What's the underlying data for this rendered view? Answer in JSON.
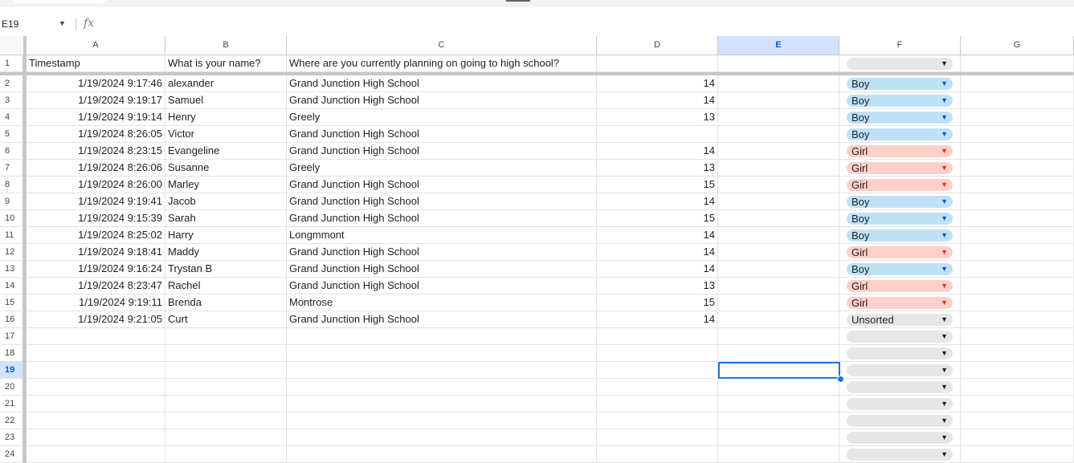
{
  "formula_bar": {
    "name_box": "E19",
    "fx_icon": "fx"
  },
  "columns": [
    "A",
    "B",
    "C",
    "D",
    "E",
    "F",
    "G"
  ],
  "selected_column": "E",
  "selected_row": 19,
  "colors": {
    "boy_chip": "#bfe1f6",
    "girl_chip": "#ffcfc9",
    "neutral_chip": "#e6e6e6",
    "selection": "#1a73e8"
  },
  "header_row": {
    "num": "1",
    "a": "Timestamp",
    "b": "What is your name?",
    "c": "Where are you currently planning on going to high school?",
    "d": "",
    "e": "",
    "f": ""
  },
  "rows": [
    {
      "num": "2",
      "a": "1/19/2024 9:17:46",
      "b": "alexander",
      "c": "Grand Junction High School",
      "d": "14",
      "f": "Boy"
    },
    {
      "num": "3",
      "a": "1/19/2024 9:19:17",
      "b": "Samuel",
      "c": "Grand Junction High School",
      "d": "14",
      "f": "Boy"
    },
    {
      "num": "4",
      "a": "1/19/2024 9:19:14",
      "b": "Henry",
      "c": "Greely",
      "d": "13",
      "f": "Boy"
    },
    {
      "num": "5",
      "a": "1/19/2024 8:26:05",
      "b": "Victor",
      "c": "Grand Junction High School",
      "d": "",
      "f": "Boy"
    },
    {
      "num": "6",
      "a": "1/19/2024 8:23:15",
      "b": "Evangeline",
      "c": "Grand Junction High School",
      "d": "14",
      "f": "Girl"
    },
    {
      "num": "7",
      "a": "1/19/2024 8:26:06",
      "b": "Susanne",
      "c": "Greely",
      "d": "13",
      "f": "Girl"
    },
    {
      "num": "8",
      "a": "1/19/2024 8:26:00",
      "b": "Marley",
      "c": "Grand Junction High School",
      "d": "15",
      "f": "Girl"
    },
    {
      "num": "9",
      "a": "1/19/2024 9:19:41",
      "b": "Jacob",
      "c": "Grand Junction High School",
      "d": "14",
      "f": "Boy"
    },
    {
      "num": "10",
      "a": "1/19/2024 9:15:39",
      "b": "Sarah",
      "c": "Grand Junction High School",
      "d": "15",
      "f": "Boy"
    },
    {
      "num": "11",
      "a": "1/19/2024 8:25:02",
      "b": "Harry",
      "c": "Longmmont",
      "d": "14",
      "f": "Boy"
    },
    {
      "num": "12",
      "a": "1/19/2024 9:18:41",
      "b": "Maddy",
      "c": "Grand Junction High School",
      "d": "14",
      "f": "Girl"
    },
    {
      "num": "13",
      "a": "1/19/2024 9:16:24",
      "b": "Trystan B",
      "c": "Grand Junction High School",
      "d": "14",
      "f": "Boy"
    },
    {
      "num": "14",
      "a": "1/19/2024 8:23:47",
      "b": "Rachel",
      "c": "Grand Junction High School",
      "d": "13",
      "f": "Girl"
    },
    {
      "num": "15",
      "a": "1/19/2024 9:19:11",
      "b": "Brenda",
      "c": "Montrose",
      "d": "15",
      "f": "Girl"
    },
    {
      "num": "16",
      "a": "1/19/2024 9:21:05",
      "b": "Curt",
      "c": "Grand Junction High School",
      "d": "14",
      "f": "Unsorted"
    },
    {
      "num": "17",
      "a": "",
      "b": "",
      "c": "",
      "d": "",
      "f": ""
    },
    {
      "num": "18",
      "a": "",
      "b": "",
      "c": "",
      "d": "",
      "f": ""
    },
    {
      "num": "19",
      "a": "",
      "b": "",
      "c": "",
      "d": "",
      "f": ""
    },
    {
      "num": "20",
      "a": "",
      "b": "",
      "c": "",
      "d": "",
      "f": ""
    },
    {
      "num": "21",
      "a": "",
      "b": "",
      "c": "",
      "d": "",
      "f": ""
    },
    {
      "num": "22",
      "a": "",
      "b": "",
      "c": "",
      "d": "",
      "f": ""
    },
    {
      "num": "23",
      "a": "",
      "b": "",
      "c": "",
      "d": "",
      "f": ""
    },
    {
      "num": "24",
      "a": "",
      "b": "",
      "c": "",
      "d": "",
      "f": ""
    }
  ]
}
